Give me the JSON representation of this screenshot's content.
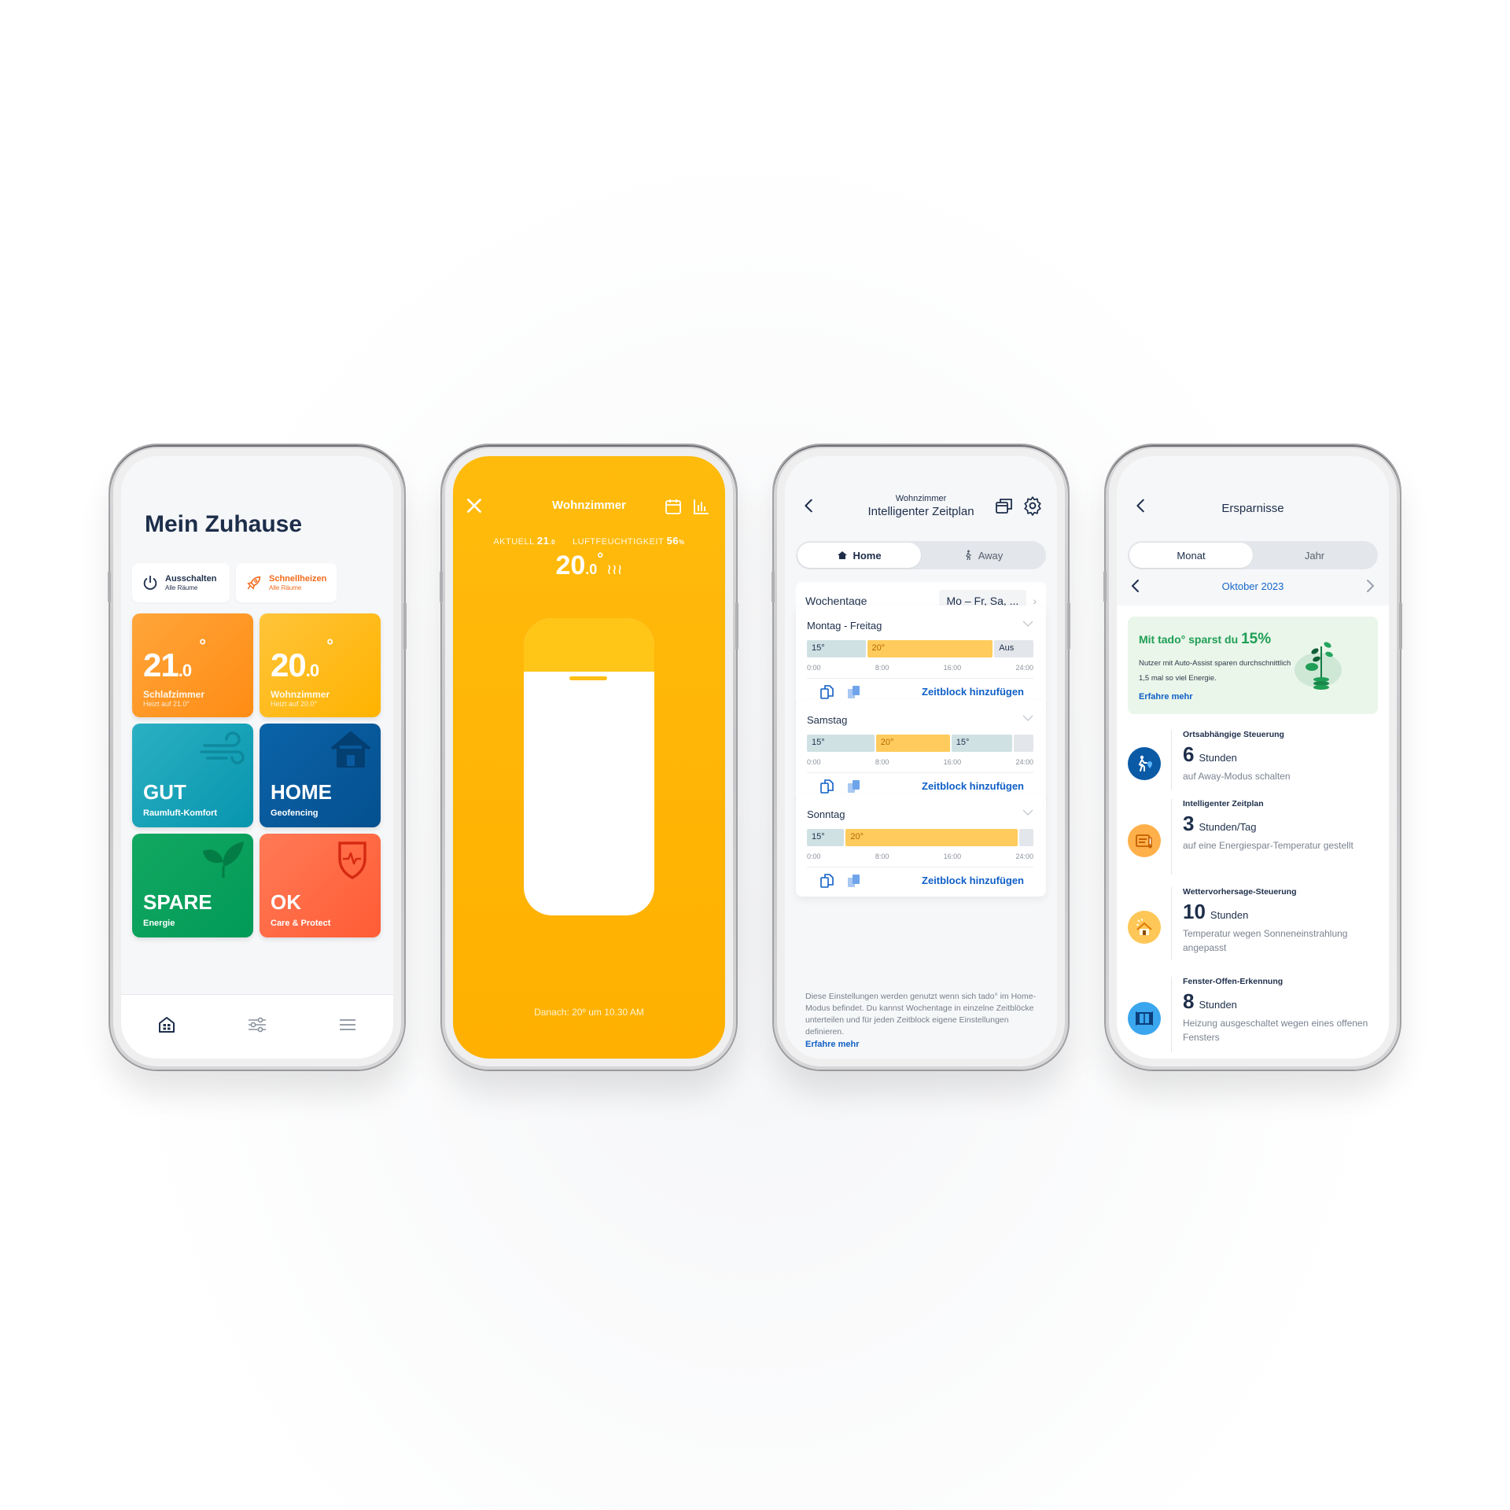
{
  "colors": {
    "navy": "#1d2e4a",
    "orange": "#ff8c14",
    "yellow": "#ffb300",
    "teal": "#0795ae",
    "blue": "#04508f",
    "green": "#019a57",
    "coral": "#ff5c35",
    "link": "#0f5fc6",
    "promo_green": "#1f9e55"
  },
  "home": {
    "title": "Mein Zuhause",
    "quick_actions": [
      {
        "label": "Ausschalten",
        "sub": "Alle Räume",
        "icon": "power-icon"
      },
      {
        "label": "Schnellheizen",
        "sub": "Alle Räume",
        "icon": "rocket-icon"
      }
    ],
    "rooms": [
      {
        "temp_int": "21",
        "temp_dec": ".0",
        "deg": "°",
        "name": "Schlafzimmer",
        "status": "Heizt auf 21.0°"
      },
      {
        "temp_int": "20",
        "temp_dec": ".0",
        "deg": "°",
        "name": "Wohnzimmer",
        "status": "Heizt auf 20.0°"
      }
    ],
    "features": [
      {
        "value": "GUT",
        "label": "Raumluft-Komfort",
        "icon": "wind-icon"
      },
      {
        "value": "HOME",
        "label": "Geofencing",
        "icon": "house-icon"
      },
      {
        "value": "SPARE",
        "label": "Energie",
        "icon": "leaf-icon"
      },
      {
        "value": "OK",
        "label": "Care & Protect",
        "icon": "shield-pulse-icon"
      }
    ],
    "nav": [
      "home-grid-icon",
      "sliders-icon",
      "menu-icon"
    ]
  },
  "room": {
    "title": "Wohnzimmer",
    "current_label": "AKTUELL",
    "current_value": "21",
    "current_dec": ".0",
    "humidity_label": "LUFTFEUCHTIGKEIT",
    "humidity_value": "56",
    "humidity_unit": "%",
    "set_int": "20",
    "set_dec": ".0",
    "set_deg": "°",
    "heating_glyph": "≀≀≀",
    "slider_level_percent": 18,
    "next": "Danach: 20º um 10.30 AM"
  },
  "schedule": {
    "room": "Wohnzimmer",
    "title": "Intelligenter Zeitplan",
    "modes": [
      {
        "label": "Home",
        "active": true
      },
      {
        "label": "Away",
        "active": false
      }
    ],
    "weekdays_label": "Wochentage",
    "weekdays_value": "Mo – Fr, Sa, ...",
    "ticks": [
      "0:00",
      "8:00",
      "16:00",
      "24:00"
    ],
    "days": [
      {
        "name": "Montag - Freitag",
        "blocks": [
          {
            "label": "15°",
            "type": "cool",
            "start": 0,
            "end": 6.3
          },
          {
            "label": "20°",
            "type": "warm",
            "start": 6.3,
            "end": 19.8
          },
          {
            "label": "Aus",
            "type": "off",
            "start": 19.8,
            "end": 24
          }
        ]
      },
      {
        "name": "Samstag",
        "blocks": [
          {
            "label": "15°",
            "type": "cool",
            "start": 0,
            "end": 7.3
          },
          {
            "label": "20°",
            "type": "warm",
            "start": 7.3,
            "end": 15.3
          },
          {
            "label": "15°",
            "type": "cool",
            "start": 15.3,
            "end": 21.9
          },
          {
            "label": "",
            "type": "off",
            "start": 21.9,
            "end": 24
          }
        ]
      },
      {
        "name": "Sonntag",
        "blocks": [
          {
            "label": "15°",
            "type": "cool",
            "start": 0,
            "end": 4
          },
          {
            "label": "20°",
            "type": "warm",
            "start": 4,
            "end": 22.5
          },
          {
            "label": "",
            "type": "off",
            "start": 22.5,
            "end": 24
          }
        ]
      }
    ],
    "add_label": "Zeitblock hinzufügen",
    "info": "Diese Einstellungen werden genutzt wenn sich tado° im Home-Modus befindet. Du kannst Wochentage in einzelne Zeitblöcke unterteilen und für jeden Zeitblock eigene Einstellungen definieren.",
    "more": "Erfahre mehr"
  },
  "savings": {
    "title": "Ersparnisse",
    "tabs": [
      {
        "label": "Monat",
        "active": true
      },
      {
        "label": "Jahr",
        "active": false
      }
    ],
    "period": "Oktober 2023",
    "promo": {
      "head": "Mit tado° sparst du",
      "pct": "15%",
      "body": "Nutzer mit Auto-Assist sparen durchschnittlich 1,5 mal so viel Energie.",
      "more": "Erfahre mehr"
    },
    "items": [
      {
        "title": "Ortsabhängige Steuerung",
        "value": "6",
        "unit": "Stunden",
        "desc": "auf Away-Modus schalten",
        "icon": "geofence-walker-icon",
        "color": "#0a5aa6"
      },
      {
        "title": "Intelligenter Zeitplan",
        "value": "3",
        "unit": "Stunden/Tag",
        "desc": "auf eine Energiespar-Temperatur gestellt",
        "icon": "calendar-thermometer-icon",
        "color": "#ffb04a"
      },
      {
        "title": "Wettervorhersage-Steuerung",
        "value": "10",
        "unit": "Stunden",
        "desc": "Temperatur wegen Sonneneinstrahlung angepasst",
        "icon": "sun-house-icon",
        "color": "#ffc758"
      },
      {
        "title": "Fenster-Offen-Erkennung",
        "value": "8",
        "unit": "Stunden",
        "desc": "Heizung ausgeschaltet wegen eines offenen Fensters",
        "icon": "open-window-icon",
        "color": "#3aa6ee"
      }
    ]
  }
}
